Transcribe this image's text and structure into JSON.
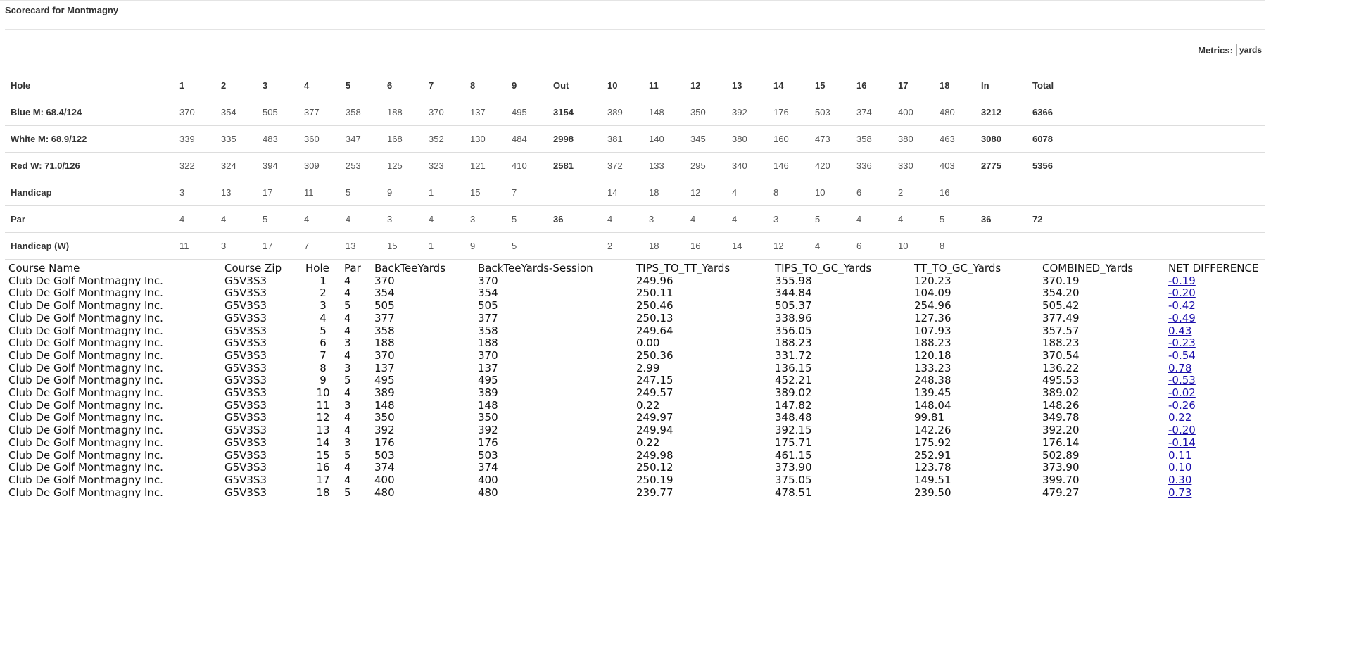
{
  "page": {
    "title": "Scorecard for Montmagny",
    "metrics_label": "Metrics:",
    "metrics_value": "yards"
  },
  "scorecard": {
    "header": [
      "Hole",
      "1",
      "2",
      "3",
      "4",
      "5",
      "6",
      "7",
      "8",
      "9",
      "Out",
      "10",
      "11",
      "12",
      "13",
      "14",
      "15",
      "16",
      "17",
      "18",
      "In",
      "Total"
    ],
    "rows": [
      {
        "label": "Blue M: 68.4/124",
        "cells": [
          "370",
          "354",
          "505",
          "377",
          "358",
          "188",
          "370",
          "137",
          "495",
          "3154",
          "389",
          "148",
          "350",
          "392",
          "176",
          "503",
          "374",
          "400",
          "480",
          "3212",
          "6366"
        ]
      },
      {
        "label": "White M: 68.9/122",
        "cells": [
          "339",
          "335",
          "483",
          "360",
          "347",
          "168",
          "352",
          "130",
          "484",
          "2998",
          "381",
          "140",
          "345",
          "380",
          "160",
          "473",
          "358",
          "380",
          "463",
          "3080",
          "6078"
        ]
      },
      {
        "label": "Red W: 71.0/126",
        "cells": [
          "322",
          "324",
          "394",
          "309",
          "253",
          "125",
          "323",
          "121",
          "410",
          "2581",
          "372",
          "133",
          "295",
          "340",
          "146",
          "420",
          "336",
          "330",
          "403",
          "2775",
          "5356"
        ]
      },
      {
        "label": "Handicap",
        "cells": [
          "3",
          "13",
          "17",
          "11",
          "5",
          "9",
          "1",
          "15",
          "7",
          "",
          "14",
          "18",
          "12",
          "4",
          "8",
          "10",
          "6",
          "2",
          "16",
          "",
          ""
        ]
      },
      {
        "label": "Par",
        "cells": [
          "4",
          "4",
          "5",
          "4",
          "4",
          "3",
          "4",
          "3",
          "5",
          "36",
          "4",
          "3",
          "4",
          "4",
          "3",
          "5",
          "4",
          "4",
          "5",
          "36",
          "72"
        ]
      },
      {
        "label": "Handicap (W)",
        "cells": [
          "11",
          "3",
          "17",
          "7",
          "13",
          "15",
          "1",
          "9",
          "5",
          "",
          "2",
          "18",
          "16",
          "14",
          "12",
          "4",
          "6",
          "10",
          "8",
          "",
          ""
        ]
      }
    ]
  },
  "raw_table": {
    "columns": [
      "Course Name",
      "Course Zip",
      "Hole",
      "Par",
      "BackTeeYards",
      "BackTeeYards-Session",
      "TIPS_TO_TT_Yards",
      "TIPS_TO_GC_Yards",
      "TT_TO_GC_Yards",
      "COMBINED_Yards",
      "NET DIFFERENCE"
    ],
    "rows": [
      [
        "Club De Golf Montmagny Inc.",
        "G5V3S3",
        "1",
        "4",
        "370",
        "370",
        "249.96",
        "355.98",
        "120.23",
        "370.19",
        "-0.19"
      ],
      [
        "Club De Golf Montmagny Inc.",
        "G5V3S3",
        "2",
        "4",
        "354",
        "354",
        "250.11",
        "344.84",
        "104.09",
        "354.20",
        "-0.20"
      ],
      [
        "Club De Golf Montmagny Inc.",
        "G5V3S3",
        "3",
        "5",
        "505",
        "505",
        "250.46",
        "505.37",
        "254.96",
        "505.42",
        "-0.42"
      ],
      [
        "Club De Golf Montmagny Inc.",
        "G5V3S3",
        "4",
        "4",
        "377",
        "377",
        "250.13",
        "338.96",
        "127.36",
        "377.49",
        "-0.49"
      ],
      [
        "Club De Golf Montmagny Inc.",
        "G5V3S3",
        "5",
        "4",
        "358",
        "358",
        "249.64",
        "356.05",
        "107.93",
        "357.57",
        "0.43"
      ],
      [
        "Club De Golf Montmagny Inc.",
        "G5V3S3",
        "6",
        "3",
        "188",
        "188",
        "0.00",
        "188.23",
        "188.23",
        "188.23",
        "-0.23"
      ],
      [
        "Club De Golf Montmagny Inc.",
        "G5V3S3",
        "7",
        "4",
        "370",
        "370",
        "250.36",
        "331.72",
        "120.18",
        "370.54",
        "-0.54"
      ],
      [
        "Club De Golf Montmagny Inc.",
        "G5V3S3",
        "8",
        "3",
        "137",
        "137",
        "2.99",
        "136.15",
        "133.23",
        "136.22",
        "0.78"
      ],
      [
        "Club De Golf Montmagny Inc.",
        "G5V3S3",
        "9",
        "5",
        "495",
        "495",
        "247.15",
        "452.21",
        "248.38",
        "495.53",
        "-0.53"
      ],
      [
        "Club De Golf Montmagny Inc.",
        "G5V3S3",
        "10",
        "4",
        "389",
        "389",
        "249.57",
        "389.02",
        "139.45",
        "389.02",
        "-0.02"
      ],
      [
        "Club De Golf Montmagny Inc.",
        "G5V3S3",
        "11",
        "3",
        "148",
        "148",
        "0.22",
        "147.82",
        "148.04",
        "148.26",
        "-0.26"
      ],
      [
        "Club De Golf Montmagny Inc.",
        "G5V3S3",
        "12",
        "4",
        "350",
        "350",
        "249.97",
        "348.48",
        "99.81",
        "349.78",
        "0.22"
      ],
      [
        "Club De Golf Montmagny Inc.",
        "G5V3S3",
        "13",
        "4",
        "392",
        "392",
        "249.94",
        "392.15",
        "142.26",
        "392.20",
        "-0.20"
      ],
      [
        "Club De Golf Montmagny Inc.",
        "G5V3S3",
        "14",
        "3",
        "176",
        "176",
        "0.22",
        "175.71",
        "175.92",
        "176.14",
        "-0.14"
      ],
      [
        "Club De Golf Montmagny Inc.",
        "G5V3S3",
        "15",
        "5",
        "503",
        "503",
        "249.98",
        "461.15",
        "252.91",
        "502.89",
        "0.11"
      ],
      [
        "Club De Golf Montmagny Inc.",
        "G5V3S3",
        "16",
        "4",
        "374",
        "374",
        "250.12",
        "373.90",
        "123.78",
        "373.90",
        "0.10"
      ],
      [
        "Club De Golf Montmagny Inc.",
        "G5V3S3",
        "17",
        "4",
        "400",
        "400",
        "250.19",
        "375.05",
        "149.51",
        "399.70",
        "0.30"
      ],
      [
        "Club De Golf Montmagny Inc.",
        "G5V3S3",
        "18",
        "5",
        "480",
        "480",
        "239.77",
        "478.51",
        "239.50",
        "479.27",
        "0.73"
      ]
    ]
  }
}
